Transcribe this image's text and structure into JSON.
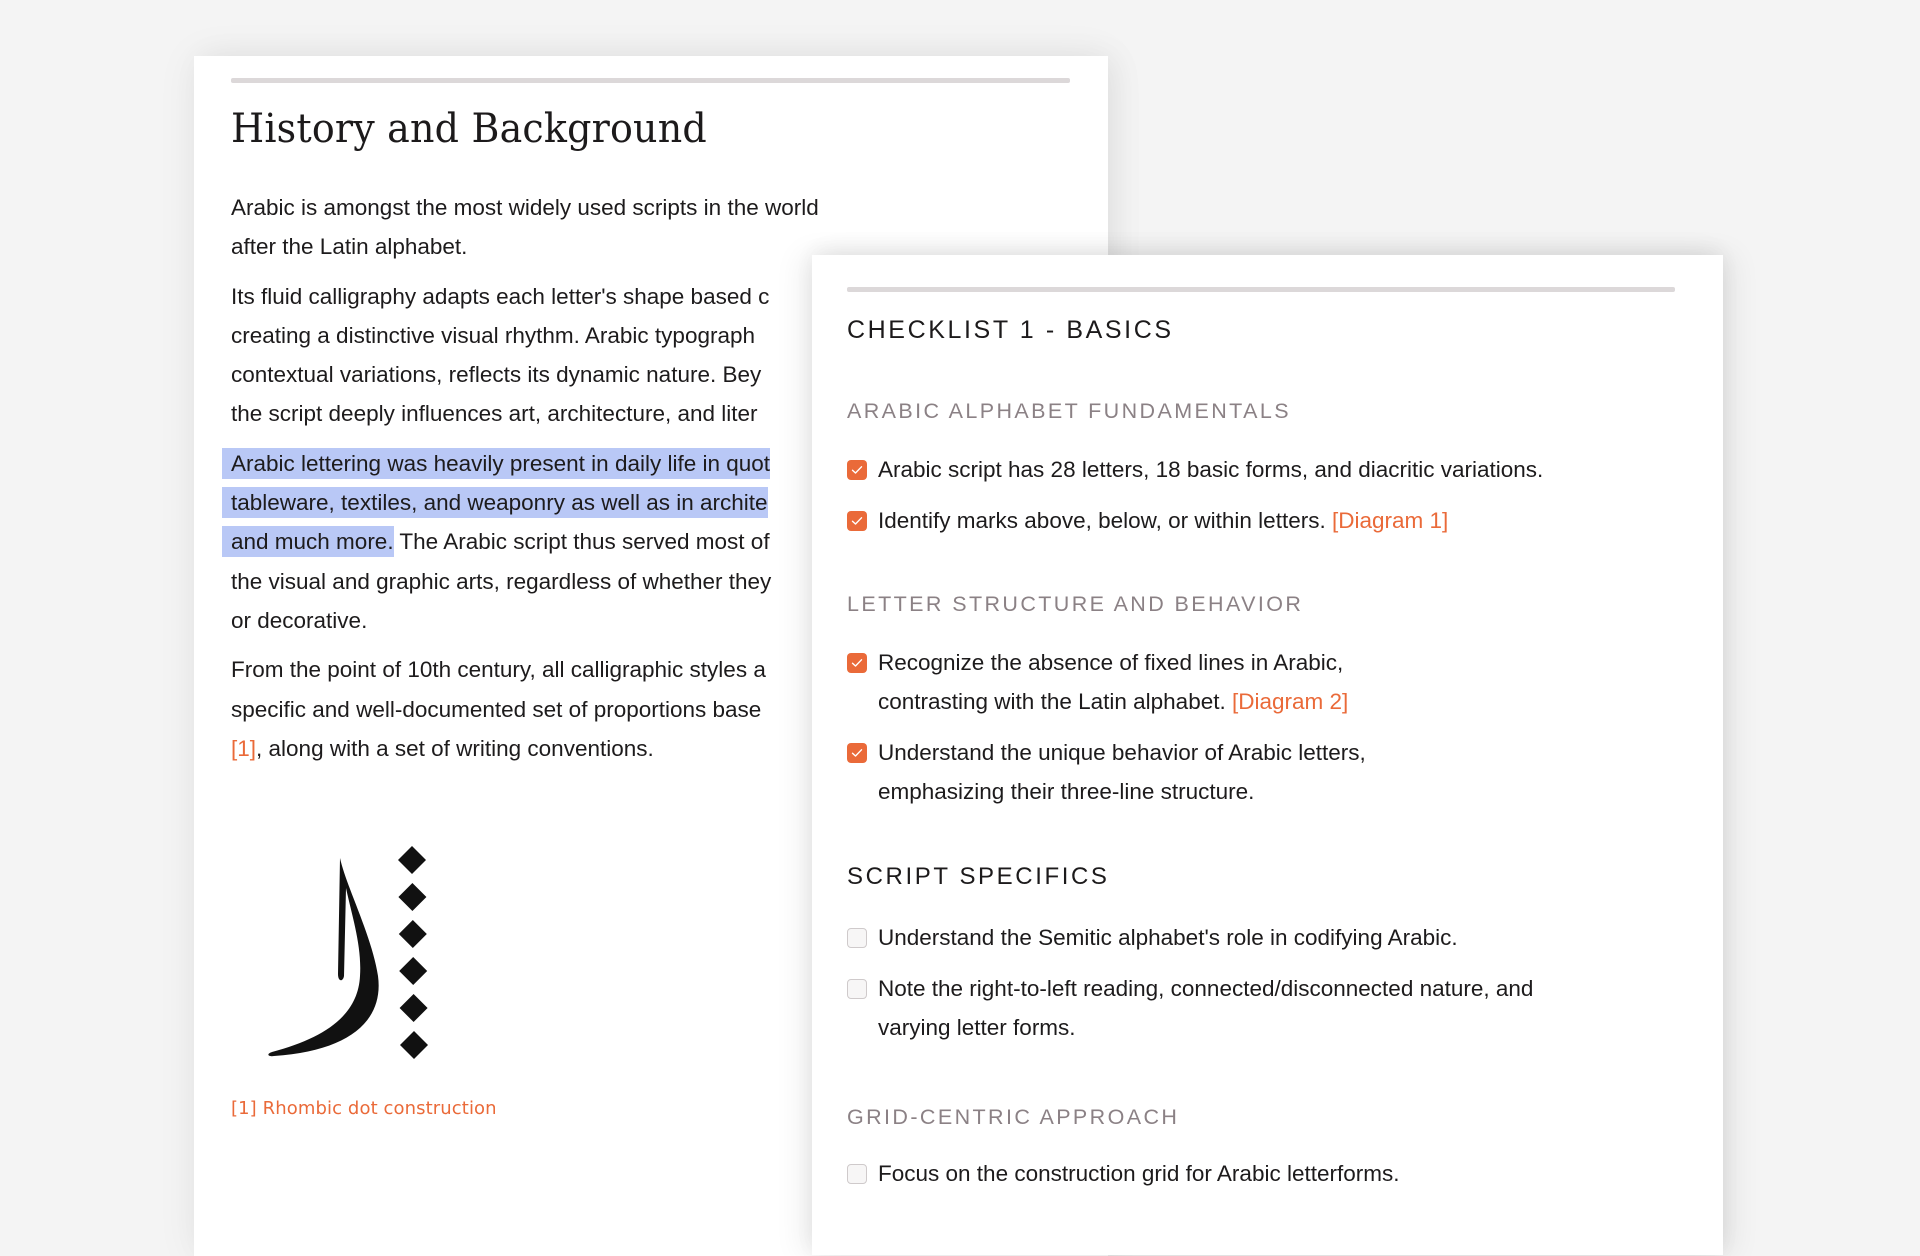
{
  "history": {
    "title": "History and Background",
    "paragraphs": {
      "p1": "Arabic is amongst the most widely used scripts in the world after the Latin alphabet.",
      "p2_lines": [
        "Its fluid calligraphy adapts each letter's shape based c",
        "creating a distinctive visual rhythm. Arabic typograph",
        "contextual variations, reflects its dynamic nature. Bey",
        "the script deeply influences art, architecture, and liter"
      ],
      "p3_highlighted_lines": [
        "Arabic lettering was heavily present in daily life in quot",
        "tableware, textiles, and weaponry as well as in archite",
        "and much more."
      ],
      "p3_rest": " The Arabic script thus served most of",
      "p3_lines_after": [
        "the visual and graphic arts, regardless of whether they",
        "or decorative."
      ],
      "p4_lines": [
        "From the point of 10th century, all calligraphic styles a",
        "specific and well-documented set of proportions base"
      ],
      "p4_ref": "[1]",
      "p4_tail": ", along with a set of writing conventions."
    },
    "figure": {
      "icon": "arabic-letter-with-rhombic-dots",
      "dot_count": 6
    },
    "caption": "[1] Rhombic dot construction"
  },
  "checklist": {
    "title": "CHECKLIST 1 - BASICS",
    "sections": [
      {
        "heading": "ARABIC ALPHABET FUNDAMENTALS",
        "items": [
          {
            "lines": [
              "Arabic script has 28 letters, 18 basic forms, and diacritic variations."
            ],
            "ref": "",
            "checked": true
          },
          {
            "lines": [
              "Identify marks above, below, or within letters. "
            ],
            "ref": "[Diagram 1]",
            "checked": true
          }
        ]
      },
      {
        "heading": "LETTER STRUCTURE AND BEHAVIOR",
        "items": [
          {
            "lines": [
              "Recognize the absence of fixed lines in Arabic,",
              "contrasting with the Latin alphabet. "
            ],
            "ref": "[Diagram 2]",
            "checked": true
          },
          {
            "lines": [
              "Understand the unique behavior of Arabic letters,",
              "emphasizing their three-line structure."
            ],
            "ref": "",
            "checked": true
          }
        ]
      },
      {
        "heading": "SCRIPT SPECIFICS",
        "items": [
          {
            "lines": [
              "Understand the Semitic alphabet's role in codifying Arabic."
            ],
            "ref": "",
            "checked": false
          },
          {
            "lines": [
              "Note the right-to-left reading, connected/disconnected nature, and",
              "varying letter forms."
            ],
            "ref": "",
            "checked": false
          }
        ]
      },
      {
        "heading": "GRID-CENTRIC APPROACH",
        "items": [
          {
            "lines": [
              "Focus on the construction grid for Arabic letterforms."
            ],
            "ref": "",
            "checked": false
          }
        ]
      }
    ]
  },
  "colors": {
    "accent": "#ea6a39",
    "highlight": "#b9c8f6",
    "muted_heading": "#8b8185",
    "divider": "#dcd8d9",
    "background": "#f4f4f4"
  }
}
